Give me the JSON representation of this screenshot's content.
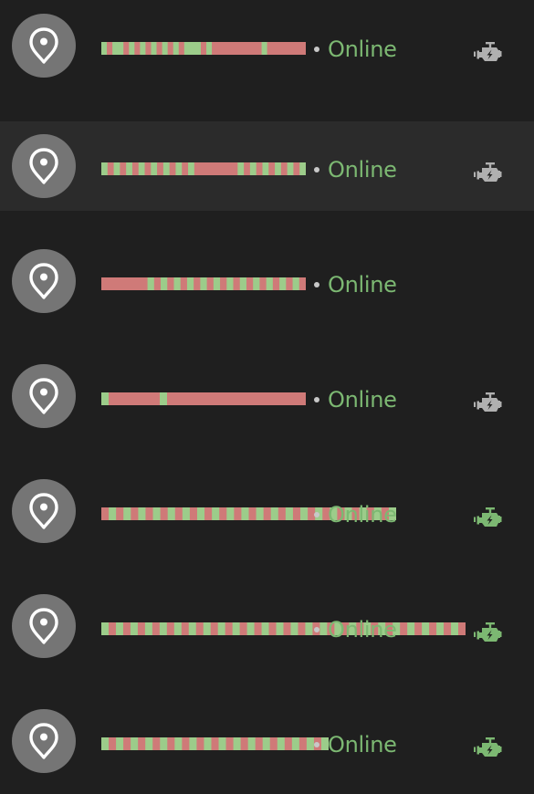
{
  "colors": {
    "background": "#1f1f1f",
    "selected_row_background": "#2b2b2b",
    "avatar_background": "#757575",
    "bar_red": "#cf7a78",
    "bar_green": "#9ccc8a",
    "status_online": "#7cb872",
    "status_dot": "#c8c8c8",
    "engine_inactive": "#b0b0b0",
    "engine_active": "#7cb872"
  },
  "rows": [
    {
      "status": "Online",
      "selected": false,
      "avatar_icon": "map-marker-icon",
      "engine_icon": "engine-icon",
      "engine_state": "inactive",
      "timeline": {
        "extent": 1.0,
        "segments": [
          [
            "g",
            1
          ],
          [
            "r",
            1
          ],
          [
            "g",
            2
          ],
          [
            "r",
            1
          ],
          [
            "g",
            1
          ],
          [
            "r",
            1
          ],
          [
            "g",
            1
          ],
          [
            "r",
            1
          ],
          [
            "g",
            1
          ],
          [
            "r",
            1
          ],
          [
            "g",
            1
          ],
          [
            "r",
            1
          ],
          [
            "g",
            1
          ],
          [
            "r",
            1
          ],
          [
            "g",
            3
          ],
          [
            "r",
            1
          ],
          [
            "g",
            1
          ],
          [
            "r",
            9
          ],
          [
            "g",
            1
          ],
          [
            "r",
            7
          ]
        ]
      }
    },
    {
      "status": "Online",
      "selected": true,
      "avatar_icon": "map-marker-icon",
      "engine_icon": "engine-icon",
      "engine_state": "inactive",
      "timeline": {
        "extent": 1.0,
        "segments": [
          [
            "g",
            1
          ],
          [
            "r",
            1
          ],
          [
            "g",
            1
          ],
          [
            "r",
            1
          ],
          [
            "g",
            1
          ],
          [
            "r",
            1
          ],
          [
            "g",
            1
          ],
          [
            "r",
            1
          ],
          [
            "g",
            1
          ],
          [
            "r",
            1
          ],
          [
            "g",
            1
          ],
          [
            "r",
            1
          ],
          [
            "g",
            1
          ],
          [
            "r",
            1
          ],
          [
            "g",
            1
          ],
          [
            "r",
            7
          ],
          [
            "g",
            1
          ],
          [
            "r",
            1
          ],
          [
            "g",
            1
          ],
          [
            "r",
            1
          ],
          [
            "g",
            1
          ],
          [
            "r",
            1
          ],
          [
            "g",
            1
          ],
          [
            "r",
            1
          ],
          [
            "g",
            1
          ],
          [
            "r",
            1
          ],
          [
            "g",
            1
          ]
        ]
      }
    },
    {
      "status": "Online",
      "selected": false,
      "avatar_icon": "map-marker-icon",
      "engine_icon": "",
      "engine_state": "none",
      "timeline": {
        "extent": 1.0,
        "segments": [
          [
            "r",
            7
          ],
          [
            "g",
            1
          ],
          [
            "r",
            1
          ],
          [
            "g",
            1
          ],
          [
            "r",
            1
          ],
          [
            "g",
            1
          ],
          [
            "r",
            1
          ],
          [
            "g",
            1
          ],
          [
            "r",
            1
          ],
          [
            "g",
            1
          ],
          [
            "r",
            1
          ],
          [
            "g",
            1
          ],
          [
            "r",
            1
          ],
          [
            "g",
            1
          ],
          [
            "r",
            1
          ],
          [
            "g",
            1
          ],
          [
            "r",
            1
          ],
          [
            "g",
            1
          ],
          [
            "r",
            1
          ],
          [
            "g",
            1
          ],
          [
            "r",
            1
          ],
          [
            "g",
            1
          ],
          [
            "r",
            1
          ],
          [
            "g",
            1
          ],
          [
            "r",
            1
          ]
        ]
      }
    },
    {
      "status": "Online",
      "selected": false,
      "avatar_icon": "map-marker-icon",
      "engine_icon": "engine-icon",
      "engine_state": "inactive",
      "timeline": {
        "extent": 1.0,
        "segments": [
          [
            "g",
            1
          ],
          [
            "r",
            7
          ],
          [
            "g",
            1
          ],
          [
            "r",
            19
          ]
        ]
      }
    },
    {
      "status": "Online",
      "selected": false,
      "avatar_icon": "map-marker-icon",
      "engine_icon": "engine-icon",
      "engine_state": "active",
      "timeline": {
        "extent": 1.44,
        "segments": [
          [
            "r",
            1
          ],
          [
            "g",
            1
          ],
          [
            "r",
            1
          ],
          [
            "g",
            1
          ],
          [
            "r",
            1
          ],
          [
            "g",
            1
          ],
          [
            "r",
            1
          ],
          [
            "g",
            1
          ],
          [
            "r",
            1
          ],
          [
            "g",
            1
          ],
          [
            "r",
            1
          ],
          [
            "g",
            1
          ],
          [
            "r",
            1
          ],
          [
            "g",
            1
          ],
          [
            "r",
            1
          ],
          [
            "g",
            1
          ],
          [
            "r",
            1
          ],
          [
            "g",
            1
          ],
          [
            "r",
            1
          ],
          [
            "g",
            1
          ],
          [
            "r",
            1
          ],
          [
            "g",
            1
          ],
          [
            "r",
            1
          ],
          [
            "g",
            1
          ],
          [
            "r",
            1
          ],
          [
            "g",
            1
          ],
          [
            "r",
            1
          ],
          [
            "g",
            1
          ],
          [
            "r",
            1
          ],
          [
            "g",
            1
          ],
          [
            "r",
            1
          ],
          [
            "g",
            1
          ],
          [
            "r",
            1
          ],
          [
            "g",
            1
          ],
          [
            "r",
            1
          ],
          [
            "g",
            1
          ],
          [
            "r",
            1
          ],
          [
            "g",
            1
          ],
          [
            "r",
            1
          ],
          [
            "g",
            1
          ]
        ]
      }
    },
    {
      "status": "Online",
      "selected": false,
      "avatar_icon": "map-marker-icon",
      "engine_icon": "engine-icon",
      "engine_state": "active",
      "timeline": {
        "extent": 1.78,
        "segments": [
          [
            "g",
            1
          ],
          [
            "r",
            1
          ],
          [
            "g",
            1
          ],
          [
            "r",
            1
          ],
          [
            "g",
            1
          ],
          [
            "r",
            1
          ],
          [
            "g",
            1
          ],
          [
            "r",
            1
          ],
          [
            "g",
            1
          ],
          [
            "r",
            1
          ],
          [
            "g",
            1
          ],
          [
            "r",
            1
          ],
          [
            "g",
            1
          ],
          [
            "r",
            1
          ],
          [
            "g",
            1
          ],
          [
            "r",
            1
          ],
          [
            "g",
            1
          ],
          [
            "r",
            1
          ],
          [
            "g",
            1
          ],
          [
            "r",
            1
          ],
          [
            "g",
            1
          ],
          [
            "r",
            1
          ],
          [
            "g",
            1
          ],
          [
            "r",
            1
          ],
          [
            "g",
            1
          ],
          [
            "r",
            1
          ],
          [
            "g",
            1
          ],
          [
            "r",
            1
          ],
          [
            "g",
            1
          ],
          [
            "r",
            1
          ],
          [
            "g",
            1
          ],
          [
            "r",
            1
          ],
          [
            "g",
            1
          ],
          [
            "r",
            1
          ],
          [
            "g",
            1
          ],
          [
            "r",
            1
          ],
          [
            "g",
            1
          ],
          [
            "r",
            1
          ],
          [
            "g",
            1
          ],
          [
            "r",
            1
          ],
          [
            "g",
            1
          ],
          [
            "r",
            1
          ],
          [
            "g",
            1
          ],
          [
            "r",
            1
          ],
          [
            "g",
            1
          ],
          [
            "r",
            1
          ],
          [
            "g",
            1
          ],
          [
            "r",
            1
          ],
          [
            "g",
            1
          ],
          [
            "r",
            1
          ]
        ]
      }
    },
    {
      "status": "Online",
      "selected": false,
      "avatar_icon": "map-marker-icon",
      "engine_icon": "engine-icon",
      "engine_state": "active",
      "timeline": {
        "extent": 1.11,
        "segments": [
          [
            "g",
            1
          ],
          [
            "r",
            1
          ],
          [
            "g",
            1
          ],
          [
            "r",
            1
          ],
          [
            "g",
            1
          ],
          [
            "r",
            1
          ],
          [
            "g",
            1
          ],
          [
            "r",
            1
          ],
          [
            "g",
            1
          ],
          [
            "r",
            1
          ],
          [
            "g",
            1
          ],
          [
            "r",
            1
          ],
          [
            "g",
            1
          ],
          [
            "r",
            1
          ],
          [
            "g",
            1
          ],
          [
            "r",
            1
          ],
          [
            "g",
            1
          ],
          [
            "r",
            1
          ],
          [
            "g",
            1
          ],
          [
            "r",
            1
          ],
          [
            "g",
            1
          ],
          [
            "r",
            1
          ],
          [
            "g",
            1
          ],
          [
            "r",
            1
          ],
          [
            "g",
            1
          ],
          [
            "r",
            1
          ],
          [
            "g",
            1
          ],
          [
            "r",
            1
          ],
          [
            "g",
            1
          ],
          [
            "r",
            1
          ],
          [
            "g",
            1
          ]
        ]
      }
    }
  ]
}
